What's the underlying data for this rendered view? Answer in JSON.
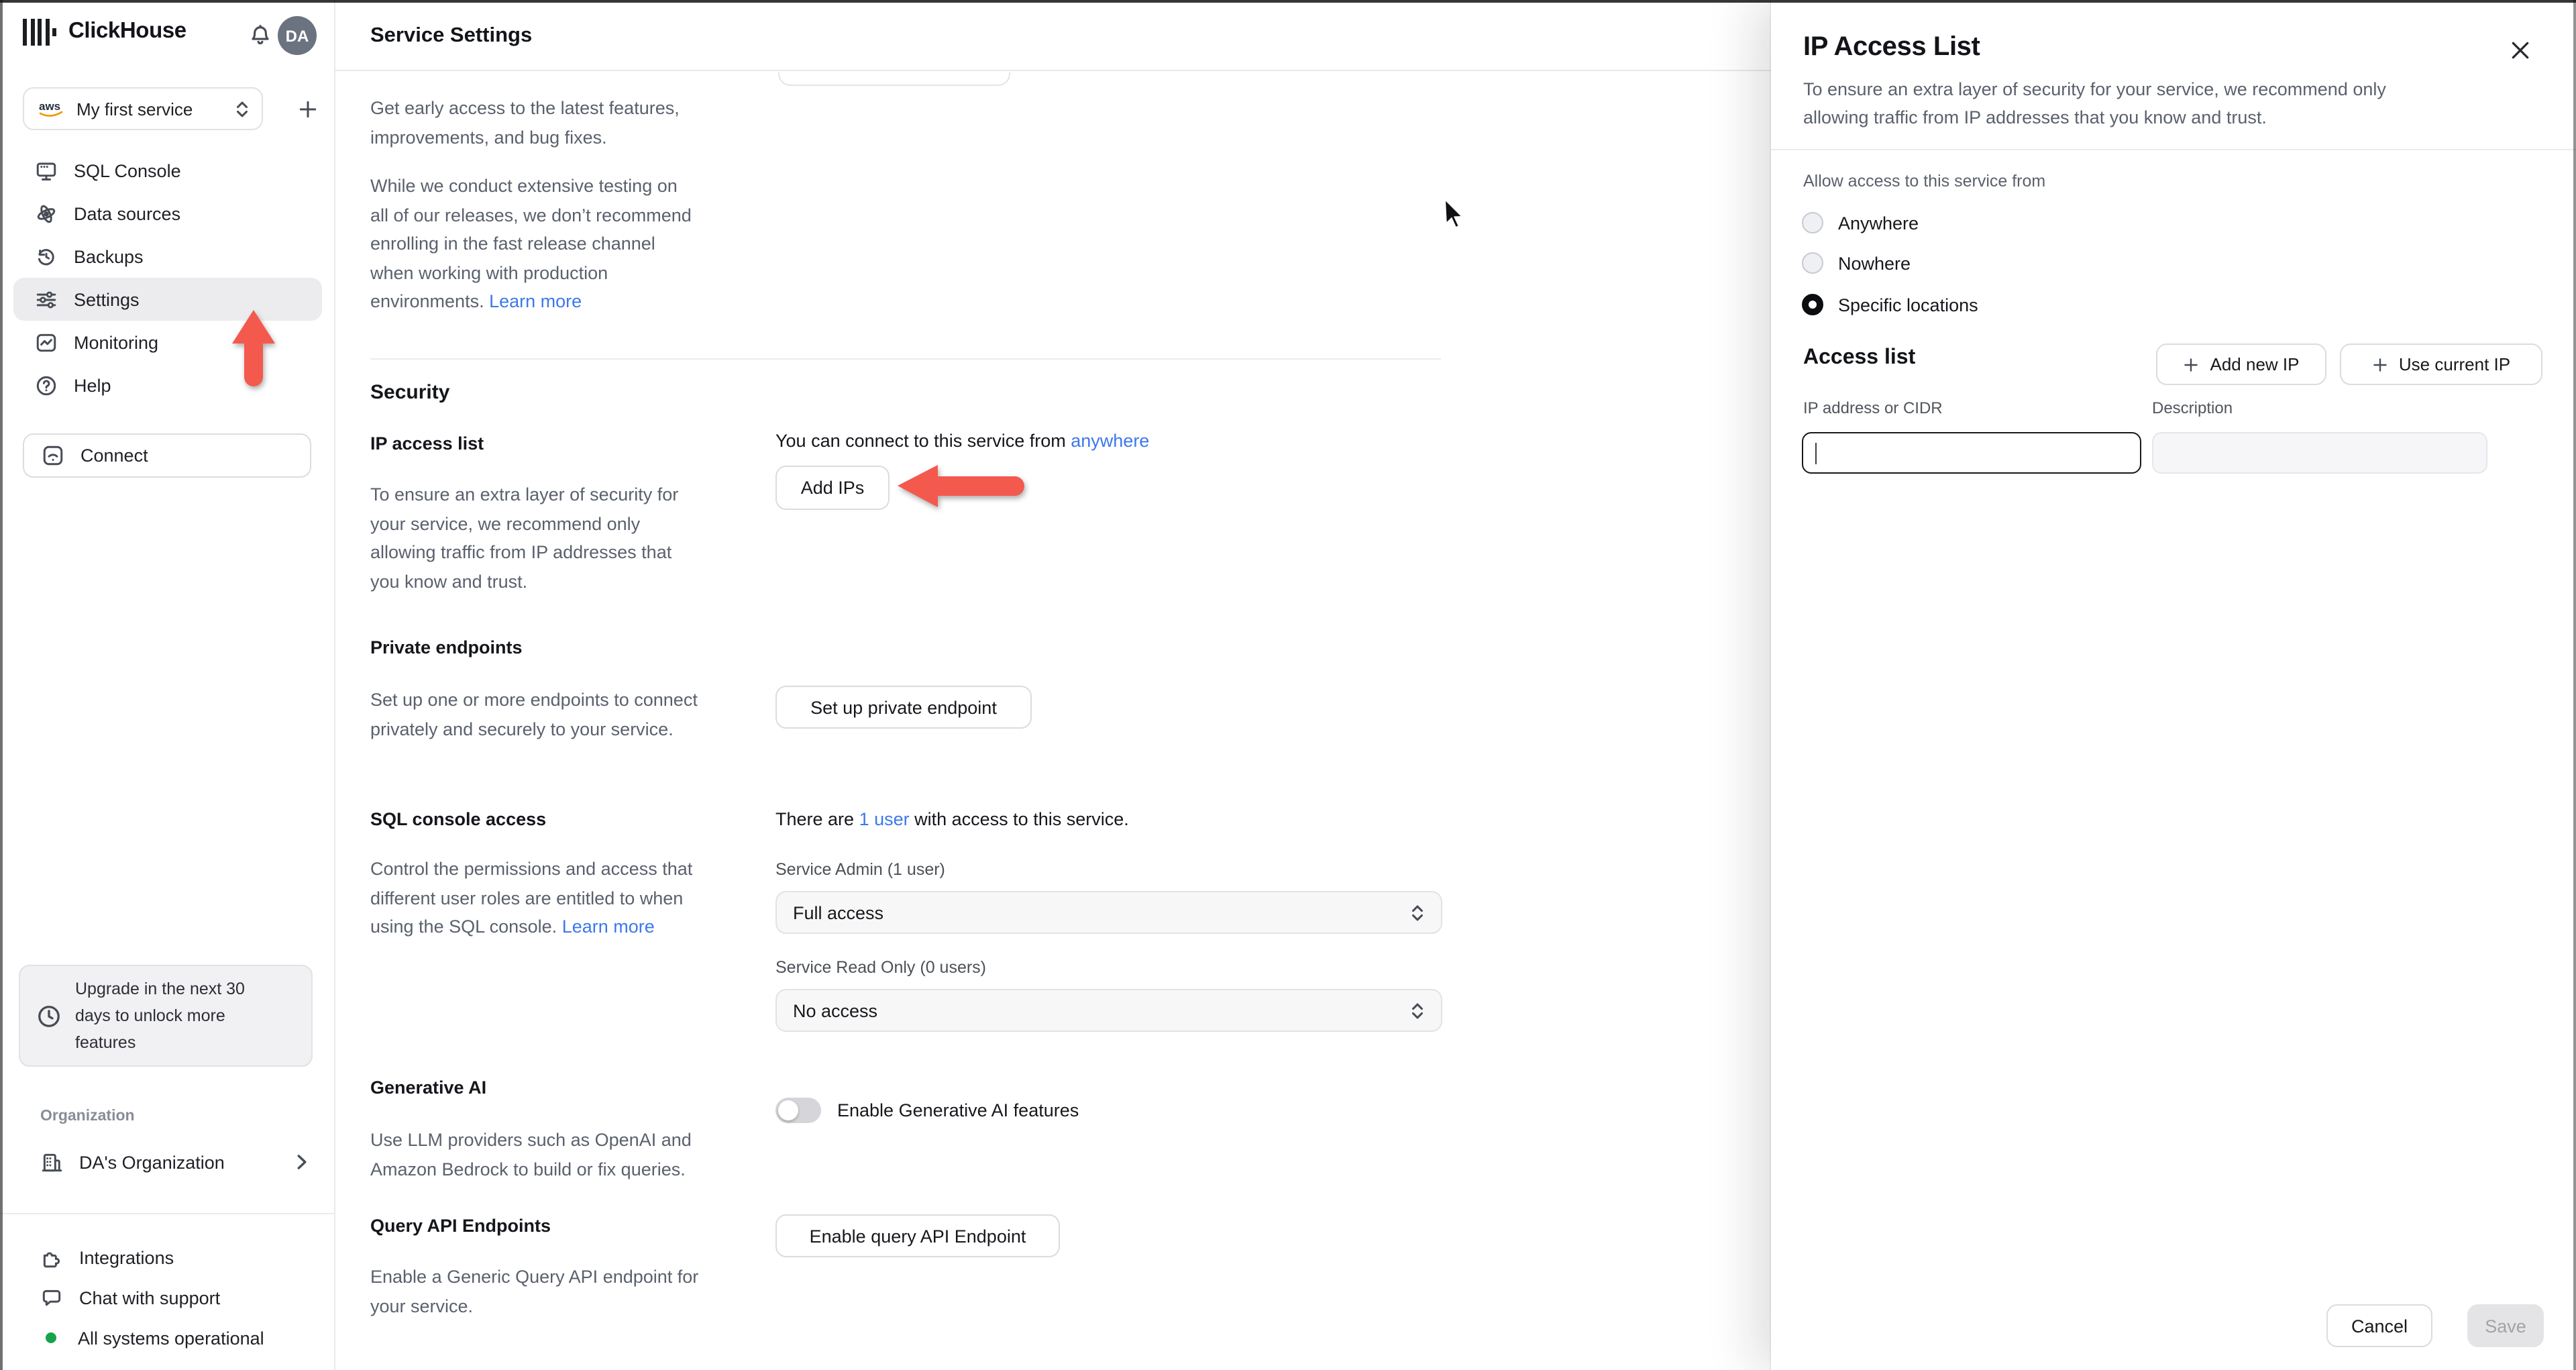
{
  "colors": {
    "accent_link": "#3c78ed",
    "arrow_red": "#f4594e",
    "status_green": "#17a34b",
    "avatar_gray": "#6b7280",
    "selected_row": "#ececef"
  },
  "brand": {
    "name": "ClickHouse",
    "avatar_initials": "DA"
  },
  "service_selector": {
    "provider": "aws",
    "label": "My first service"
  },
  "sidebar": {
    "items": [
      {
        "label": "SQL Console"
      },
      {
        "label": "Data sources"
      },
      {
        "label": "Backups"
      },
      {
        "label": "Settings",
        "active": true
      },
      {
        "label": "Monitoring"
      },
      {
        "label": "Help"
      }
    ],
    "connect_label": "Connect",
    "upgrade_lines": [
      "Upgrade in the next 30",
      "days to unlock more",
      "features"
    ],
    "organization_label": "Organization",
    "organization_name": "DA's Organization",
    "footer_items": [
      {
        "label": "Integrations"
      },
      {
        "label": "Chat with support"
      }
    ],
    "status_text": "All systems operational"
  },
  "main": {
    "title": "Service Settings",
    "fast_release": {
      "p1_lines": [
        "Get early access to the latest features,",
        "improvements, and bug fixes."
      ],
      "p2_lines": [
        "While we conduct extensive testing on",
        "all of our releases, we don’t recommend",
        "enrolling in the fast release channel",
        "when working with production"
      ],
      "p2_last": "environments. ",
      "learn_more": "Learn more"
    },
    "security_heading": "Security",
    "ip_access": {
      "heading": "IP access list",
      "desc_lines": [
        "To ensure an extra layer of security for",
        "your service, we recommend only",
        "allowing traffic from IP addresses that",
        "you know and trust."
      ],
      "sentence_prefix": "You can connect to this service from ",
      "sentence_link": "anywhere",
      "add_ips_label": "Add IPs"
    },
    "private_endpoints": {
      "heading": "Private endpoints",
      "desc_lines": [
        "Set up one or more endpoints to connect",
        "privately and securely to your service."
      ],
      "button_label": "Set up private endpoint"
    },
    "sql_console": {
      "heading": "SQL console access",
      "sentence_prefix": "There are ",
      "sentence_link": "1 user",
      "sentence_suffix": " with access to this service.",
      "desc_lines": [
        "Control the permissions and access that",
        "different user roles are entitled to when"
      ],
      "desc_last": "using the SQL console. ",
      "learn_more": "Learn more",
      "admin_label": "Service Admin (1 user)",
      "admin_value": "Full access",
      "readonly_label": "Service Read Only (0 users)",
      "readonly_value": "No access"
    },
    "generative_ai": {
      "heading": "Generative AI",
      "desc_lines": [
        "Use LLM providers such as OpenAI and",
        "Amazon Bedrock to build or fix queries."
      ],
      "toggle_label": "Enable Generative AI features",
      "toggle_state": "off"
    },
    "query_api": {
      "heading": "Query API Endpoints",
      "desc_lines": [
        "Enable a Generic Query API endpoint for",
        "your service."
      ],
      "button_label": "Enable query API Endpoint"
    }
  },
  "panel": {
    "title": "IP Access List",
    "desc_lines": [
      "To ensure an extra layer of security for your service, we recommend only",
      "allowing traffic from IP addresses that you know and trust."
    ],
    "allow_label": "Allow access to this service from",
    "radio_options": [
      {
        "label": "Anywhere",
        "selected": false
      },
      {
        "label": "Nowhere",
        "selected": false
      },
      {
        "label": "Specific locations",
        "selected": true
      }
    ],
    "access_list_heading": "Access list",
    "add_new_ip_label": "Add new IP",
    "use_current_ip_label": "Use current IP",
    "ip_field_label": "IP address or CIDR",
    "ip_field_value": "",
    "description_field_label": "Description",
    "description_field_value": "",
    "cancel_label": "Cancel",
    "save_label": "Save"
  }
}
